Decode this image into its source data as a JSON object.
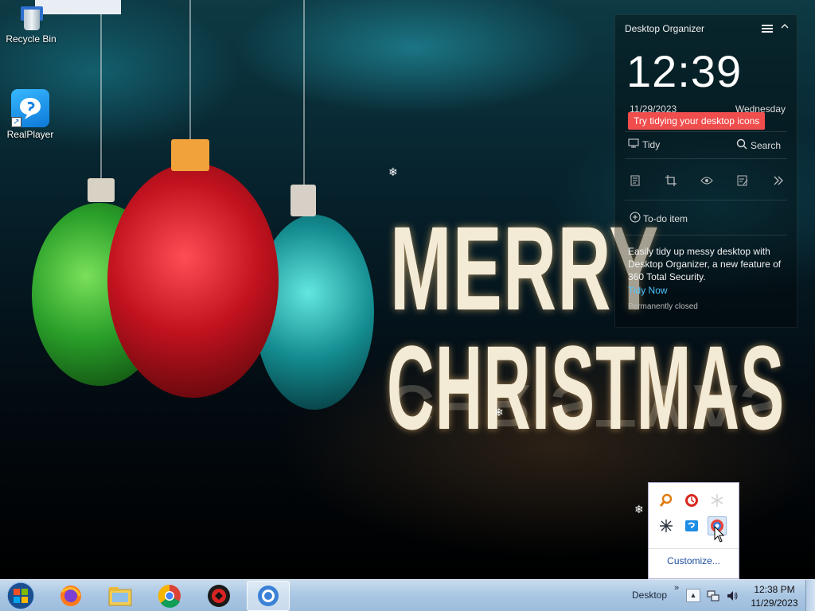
{
  "desktop": {
    "icons": [
      {
        "label": "Recycle Bin",
        "icon": "recycle-bin-icon"
      },
      {
        "label": "RealPlayer",
        "icon": "realplayer-icon"
      }
    ],
    "wallpaper_text": [
      "MERRY",
      "CHRISTMAS"
    ]
  },
  "organizer": {
    "title": "Desktop Organizer",
    "clock": "12:39",
    "date": "11/29/2023",
    "day": "Wednesday",
    "tip": "Try tidying your desktop icons",
    "tidy_label": "Tidy",
    "search_label": "Search",
    "todo_label": "To-do item",
    "description": "Easily tidy up messy desktop with Desktop Organizer, a new feature of 360 Total Security.",
    "tidy_now": "Tidy Now",
    "permanently_closed": "Permanently closed",
    "tools": [
      "notes-icon",
      "crop-icon",
      "eye-icon",
      "edit-icon",
      "more-icon"
    ]
  },
  "tray_popup": {
    "customize": "Customize...",
    "icons": [
      "search-tray-icon",
      "clock-app-icon",
      "snowflake-icon",
      "asterisk-icon",
      "chat-icon",
      "security-shield-icon"
    ]
  },
  "taskbar": {
    "apps": [
      "firefox-icon",
      "file-explorer-icon",
      "chrome-icon",
      "app-icon",
      "security-app-icon"
    ],
    "desktop_label": "Desktop",
    "time": "12:38 PM",
    "date": "11/29/2023"
  },
  "colors": {
    "tip_bg": "#f04d4d",
    "link": "#4fc6ff",
    "taskbar": "#a9c6e3"
  }
}
